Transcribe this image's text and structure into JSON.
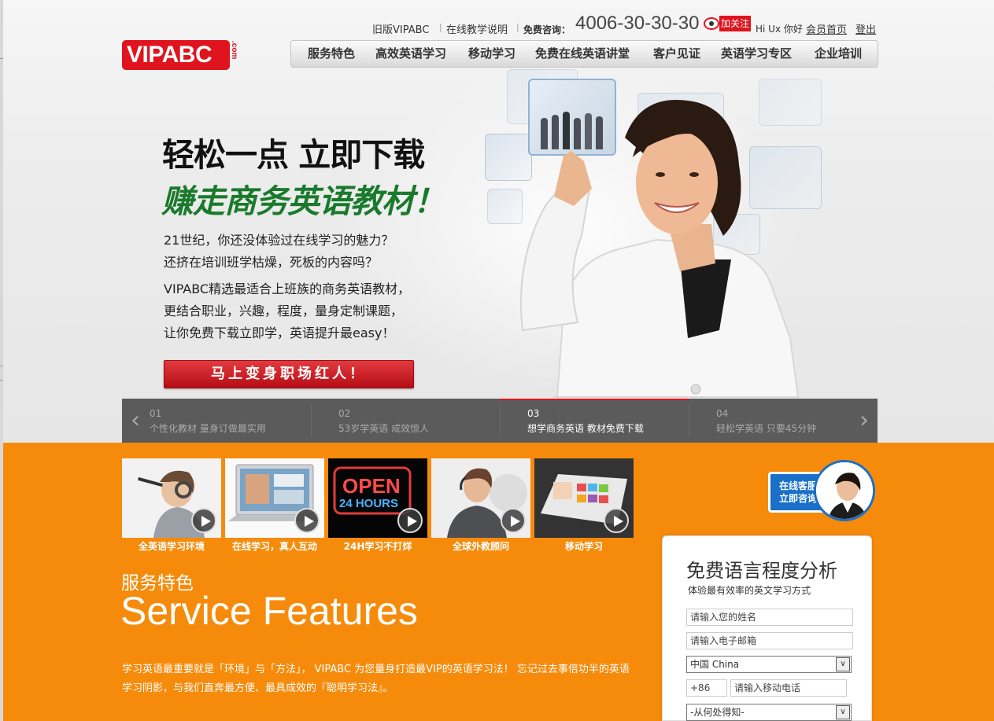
{
  "header": {
    "logo_text": "VIPABC",
    "logo_suffix": ".com",
    "links": {
      "old_version": "旧版VIPABC",
      "teaching_guide": "在线教学说明",
      "hotline_label": "免费咨询：",
      "hotline": "4006-30-30-30",
      "weibo_follow": "加关注",
      "greeting": "Hi Ux 你好",
      "member_home": "会员首页",
      "logout": "登出"
    },
    "nav": [
      "服务特色",
      "高效英语学习",
      "移动学习",
      "免费在线英语讲堂",
      "客户见证",
      "英语学习专区",
      "企业培训"
    ]
  },
  "hero": {
    "headline_1": "轻松一点 立即下载",
    "headline_2": "赚走商务英语教材！",
    "para1": [
      "21世纪，你还没体验过在线学习的魅力？",
      "还挤在培训班学枯燥，死板的内容吗？"
    ],
    "para2": [
      "VIPABC精选最适合上班族的商务英语教材，",
      "更结合职业，兴趣，程度，量身定制课题，",
      "让你免费下载立即学，英语提升最easy！"
    ],
    "cta": "马上变身职场红人！"
  },
  "slider": {
    "prev_icon": "chevron-left-icon",
    "next_icon": "chevron-right-icon",
    "active_index": 2,
    "items": [
      {
        "num": "01",
        "caption": "个性化教材  量身订做最实用"
      },
      {
        "num": "02",
        "caption": "53岁学英语  成效惊人"
      },
      {
        "num": "03",
        "caption": "想学商务英语  教材免费下载"
      },
      {
        "num": "04",
        "caption": "轻松学英语  只要45分钟"
      }
    ]
  },
  "features": {
    "thumbs": [
      {
        "caption": "全英语学习环境"
      },
      {
        "caption": "在线学习，真人互动"
      },
      {
        "caption": "24H学习不打烊",
        "sign_line1": "OPEN",
        "sign_line2": "24 HOURS"
      },
      {
        "caption": "全球外教顾问"
      },
      {
        "caption": "移动学习"
      }
    ],
    "title_cn": "服务特色",
    "title_en": "Service Features",
    "description": "学习英语最重要就是「环境」与「方法」， VIPABC 为您量身打造最VIP的英语学习法！ 忘记过去事倍功半的英语学习阴影，与我们直奔最方便、最具成效的『聪明学习法』。"
  },
  "support": {
    "label_line1": "在线客服",
    "label_line2": "立即咨询"
  },
  "form": {
    "title": "免费语言程度分析",
    "subtitle": "体验最有效率的英文学习方式",
    "name_placeholder": "请输入您的姓名",
    "email_placeholder": "请输入电子邮箱",
    "country_value": "中国 China",
    "phone_code": "+86",
    "phone_placeholder": "请输入移动电话",
    "source_value": "-从何处得知-"
  },
  "colors": {
    "brand_red": "#e0141e",
    "orange": "#f68b0b",
    "green": "#1a7a2c",
    "support_blue": "#1a6fc8"
  }
}
